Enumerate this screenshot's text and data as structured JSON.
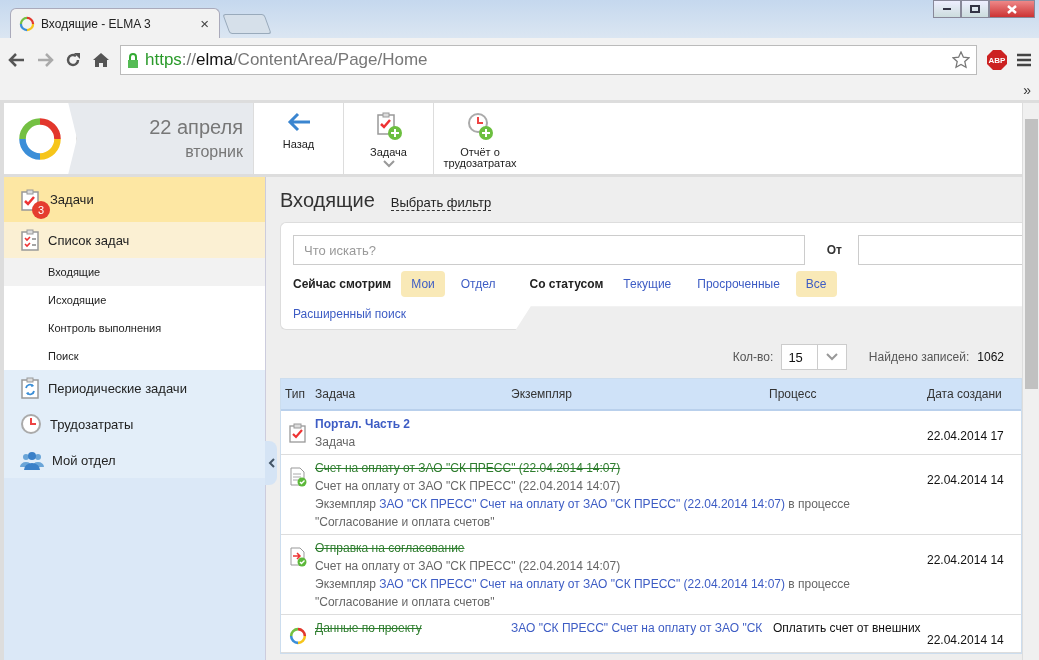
{
  "browser": {
    "tab": {
      "title": "Входящие - ELMA 3",
      "close": "×"
    },
    "address": [
      {
        "kind": "scheme",
        "text": "https"
      },
      {
        "kind": "sep",
        "text": "://"
      },
      {
        "kind": "host",
        "text": "elma"
      },
      {
        "kind": "path",
        "text": "/ContentArea/Page/Home"
      }
    ],
    "adblock": "ABP",
    "bookmarks_more": "»"
  },
  "header": {
    "date": "22 апреля",
    "weekday": "вторник",
    "toolbar": [
      {
        "label": "Назад",
        "dropdown": false
      },
      {
        "label": "Задача",
        "dropdown": true
      },
      {
        "label": "Отчёт о трудозатратах",
        "dropdown": false
      }
    ]
  },
  "sidebar": {
    "module": {
      "label": "Задачи",
      "badge": "3",
      "selected": true
    },
    "items": [
      {
        "label": "Список задач",
        "expanded": true,
        "children": [
          {
            "label": "Входящие",
            "selected": true
          },
          {
            "label": "Исходящие",
            "selected": false
          },
          {
            "label": "Контроль выполнения",
            "selected": false
          },
          {
            "label": "Поиск",
            "selected": false
          }
        ]
      },
      {
        "label": "Периодические задачи",
        "expanded": false
      },
      {
        "label": "Трудозатраты",
        "expanded": false
      },
      {
        "label": "Мой отдел",
        "expanded": false
      }
    ]
  },
  "main": {
    "title": "Входящие",
    "filter_link": "Выбрать фильтр",
    "search": {
      "placeholder": "Что искать?",
      "from_label": "От"
    },
    "filters": [
      {
        "label": "Сейчас смотрим",
        "options": [
          {
            "label": "Мои",
            "selected": true
          },
          {
            "label": "Отдел",
            "selected": false
          }
        ]
      },
      {
        "label": "Со статусом",
        "options": [
          {
            "label": "Текущие",
            "selected": false
          },
          {
            "label": "Просроченные",
            "selected": false
          },
          {
            "label": "Все",
            "selected": true
          }
        ]
      }
    ],
    "advanced_search": "Расширенный поиск",
    "count_label": "Кол-во:",
    "count_value": "15",
    "found_label": "Найдено записей:",
    "found_value": "1062",
    "table": {
      "columns": [
        "Тип",
        "Задача",
        "Экземпляр",
        "Процесс",
        "Дата создани"
      ],
      "rows": [
        {
          "kind": "task",
          "title": "Портал. Часть 2",
          "completed": false,
          "lines": [
            "Задача"
          ],
          "date": "22.04.2014 17"
        },
        {
          "kind": "document",
          "title": "Счет на оплату от ЗАО \"СК ПРЕСС\" (22.04.2014 14:07)",
          "completed": true,
          "lines": [
            "Счет на оплату от ЗАО \"СК ПРЕСС\" (22.04.2014 14:07)"
          ],
          "note": {
            "prefix": "Экземпляр",
            "link": "ЗАО \"СК ПРЕСС\" Счет на оплату от ЗАО \"СК ПРЕСС\" (22.04.2014 14:07)",
            "suffix": "в процессе \"Согласование и оплата счетов\""
          },
          "date": "22.04.2014 14"
        },
        {
          "kind": "approval",
          "title": "Отправка на согласование",
          "completed": true,
          "lines": [
            "Счет на оплату от ЗАО \"СК ПРЕСС\" (22.04.2014 14:07)"
          ],
          "note": {
            "prefix": "Экземпляр",
            "link": "ЗАО \"СК ПРЕСС\" Счет на оплату от ЗАО \"СК ПРЕСС\" (22.04.2014 14:07)",
            "suffix": "в процессе \"Согласование и оплата счетов\""
          },
          "date": "22.04.2014 14"
        },
        {
          "kind": "process",
          "title": "Данные по проекту",
          "completed": true,
          "instance": "ЗАО \"СК ПРЕСС\" Счет на оплату от ЗАО \"СК",
          "process": "Оплатить счет от внешних",
          "date": "22.04.2014 14"
        }
      ]
    }
  }
}
